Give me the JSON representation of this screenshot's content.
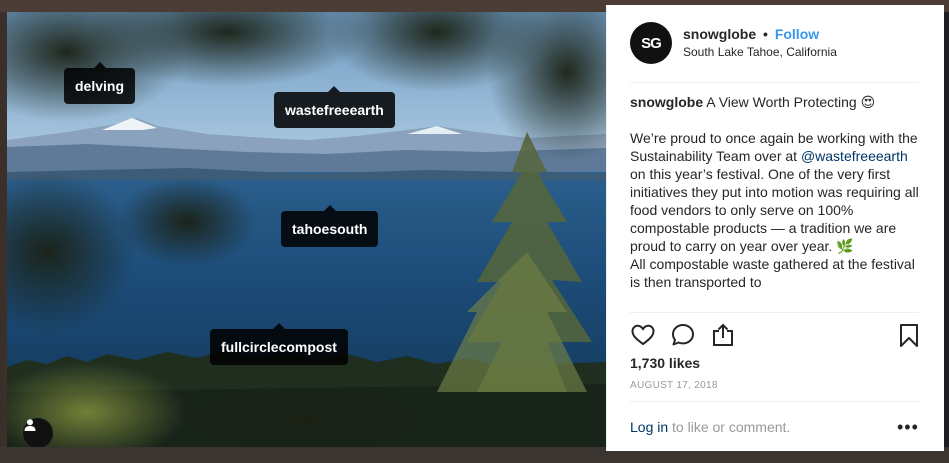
{
  "photo": {
    "tags": [
      {
        "label": "delving"
      },
      {
        "label": "wastefreeearth"
      },
      {
        "label": "tahoesouth"
      },
      {
        "label": "fullcirclecompost"
      }
    ]
  },
  "post": {
    "avatar_text": "SG",
    "username": "snowglobe",
    "separator": "•",
    "follow_label": "Follow",
    "location": "South Lake Tahoe, California",
    "caption": {
      "author": "snowglobe",
      "title": "A View Worth Protecting 😍",
      "line1": "We’re proud to once again be working with the Sustainability Team over at ",
      "mention": "@wastefreeearth",
      "line2": " on this year’s festival. One of the very first initiatives they put into motion was requiring all food vendors to only serve on 100% compostable products — a tradition we are proud to carry on year over year. 🌿",
      "line3": "All compostable waste gathered at the festival is then transported to"
    },
    "likes": "1,730 likes",
    "date": "AUGUST 17, 2018",
    "login_link": "Log in",
    "login_rest": " to like or comment.",
    "more_label": "•••",
    "icons": [
      "heart-icon",
      "comment-icon",
      "share-icon",
      "bookmark-icon",
      "user-tag-icon"
    ]
  }
}
